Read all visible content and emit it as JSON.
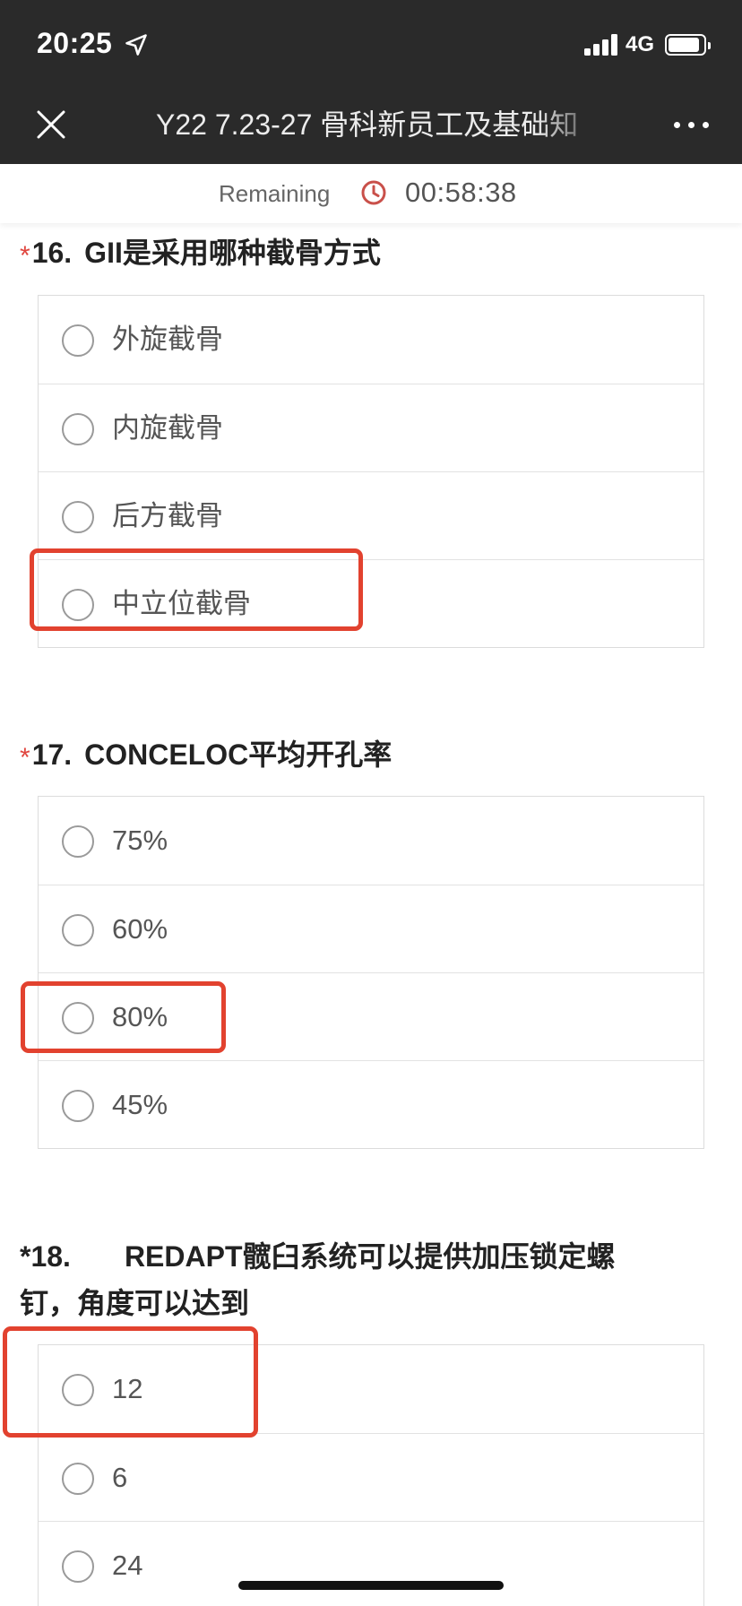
{
  "status_bar": {
    "time": "20:25",
    "network": "4G"
  },
  "nav": {
    "title": "Y22 7.23-27 骨科新员工及基础知"
  },
  "timer": {
    "label": "Remaining",
    "value": "00:58:38"
  },
  "questions": [
    {
      "required_mark": "*",
      "number": "16.",
      "text": "GII是采用哪种截骨方式",
      "options": [
        "外旋截骨",
        "内旋截骨",
        "后方截骨",
        "中立位截骨"
      ]
    },
    {
      "required_mark": "*",
      "number": "17.",
      "text": "CONCELOC平均开孔率",
      "options": [
        "75%",
        "60%",
        "80%",
        "45%"
      ]
    },
    {
      "required_mark": "*",
      "number": "18.",
      "text": "REDAPT髋臼系统可以提供加压锁定螺钉，角度可以达到",
      "options": [
        "12",
        "6",
        "24"
      ]
    }
  ],
  "colors": {
    "header_bg": "#2a2a2a",
    "required": "#e0463f",
    "annotation": "#e2422f",
    "clock": "#c9504a"
  },
  "icons": [
    "location-arrow-icon",
    "close-icon",
    "more-icon",
    "clock-icon"
  ]
}
